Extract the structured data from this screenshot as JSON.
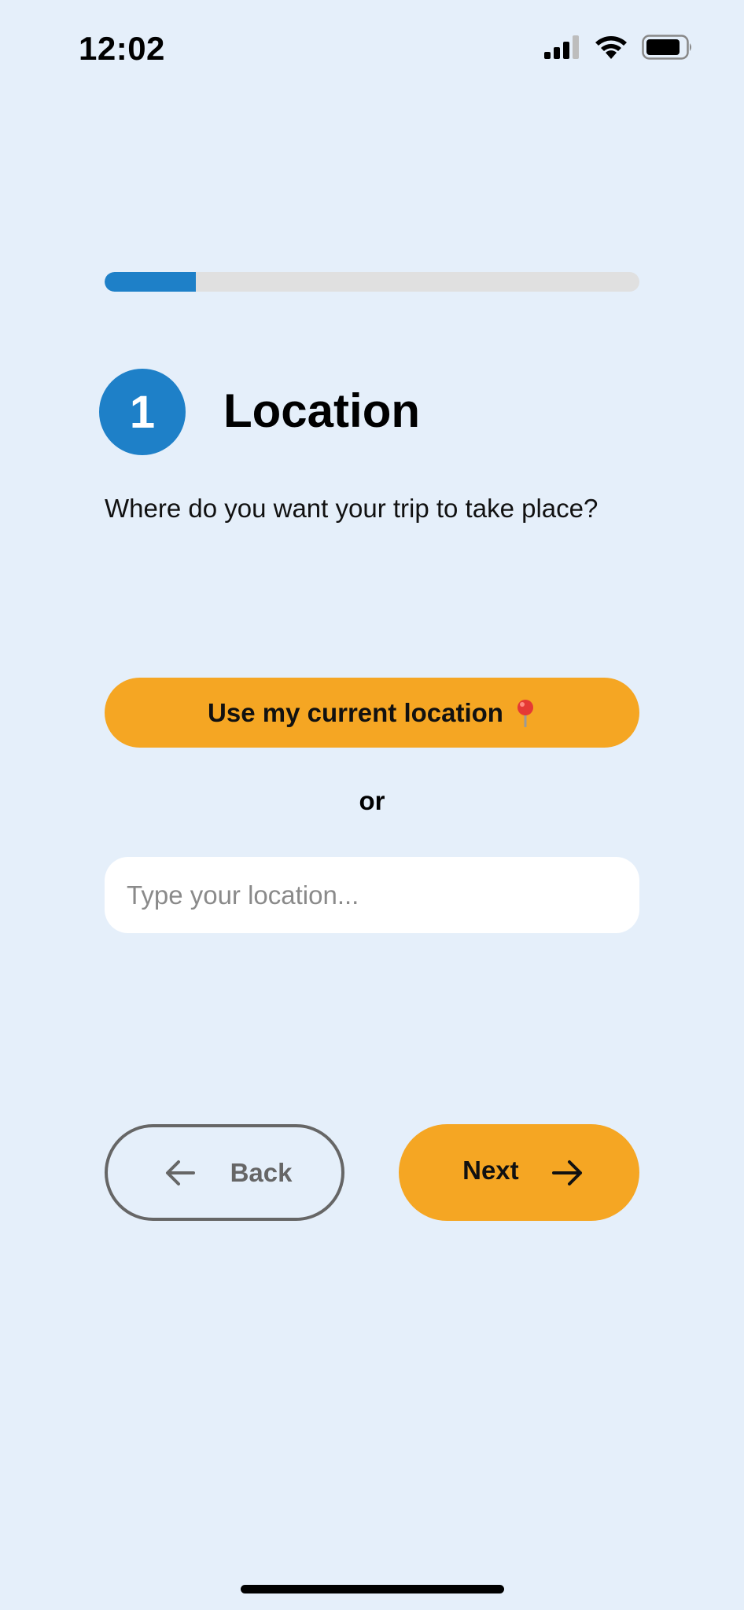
{
  "status_bar": {
    "time": "12:02",
    "icons": [
      "cellular-signal-icon",
      "wifi-icon",
      "battery-icon"
    ]
  },
  "progress": {
    "fraction": 0.17,
    "color": "#1E80C8",
    "track_color": "#E0E0E0"
  },
  "step": {
    "number": "1",
    "title": "Location",
    "question": "Where do you want your trip to take place?"
  },
  "location": {
    "use_current_label": "Use my current location",
    "use_current_icon": "map-pin-icon",
    "or_label": "or",
    "input_placeholder": "Type your location...",
    "input_value": ""
  },
  "nav": {
    "back_label": "Back",
    "back_icon": "arrow-left-icon",
    "next_label": "Next",
    "next_icon": "arrow-right-icon"
  },
  "colors": {
    "background": "#E5EFFA",
    "accent": "#F5A623",
    "primary": "#1E80C8"
  }
}
